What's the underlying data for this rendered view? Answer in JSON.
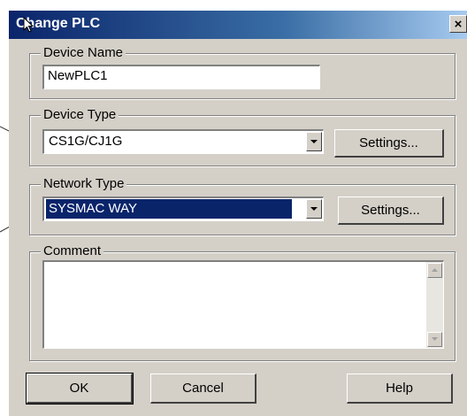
{
  "window": {
    "title": "Change PLC"
  },
  "device_name": {
    "legend": "Device Name",
    "value": "NewPLC1"
  },
  "device_type": {
    "legend": "Device Type",
    "value": "CS1G/CJ1G",
    "settings_label": "Settings..."
  },
  "network_type": {
    "legend": "Network Type",
    "value": "SYSMAC WAY",
    "settings_label": "Settings..."
  },
  "comment": {
    "legend": "Comment",
    "value": ""
  },
  "buttons": {
    "ok": "OK",
    "cancel": "Cancel",
    "help": "Help"
  },
  "icons": {
    "close": "close-icon",
    "cursor": "mouse-pointer-icon",
    "dropdown": "chevron-down-icon"
  },
  "colors": {
    "title_bar": "#0a246a",
    "selection": "#0a246a",
    "dialog_bg": "#d4d0c8"
  }
}
